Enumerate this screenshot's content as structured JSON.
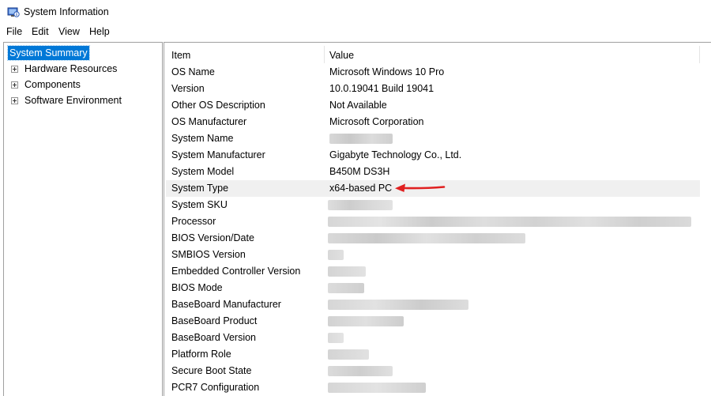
{
  "window": {
    "title": "System Information",
    "icon": "system-information-icon"
  },
  "menubar": {
    "items": [
      "File",
      "Edit",
      "View",
      "Help"
    ]
  },
  "tree": {
    "root": "System Summary",
    "items": [
      "Hardware Resources",
      "Components",
      "Software Environment"
    ]
  },
  "table": {
    "columns": [
      "Item",
      "Value"
    ],
    "rows": [
      {
        "item": "OS Name",
        "value": "Microsoft Windows 10 Pro"
      },
      {
        "item": "Version",
        "value": "10.0.19041 Build 19041"
      },
      {
        "item": "Other OS Description",
        "value": "Not Available"
      },
      {
        "item": "OS Manufacturer",
        "value": "Microsoft Corporation"
      },
      {
        "item": "System Name",
        "value": ""
      },
      {
        "item": "System Manufacturer",
        "value": "Gigabyte Technology Co., Ltd."
      },
      {
        "item": "System Model",
        "value": "B450M DS3H"
      },
      {
        "item": "System Type",
        "value": "x64-based PC"
      },
      {
        "item": "System SKU",
        "value": ""
      },
      {
        "item": "Processor",
        "value": ""
      },
      {
        "item": "BIOS Version/Date",
        "value": ""
      },
      {
        "item": "SMBIOS Version",
        "value": ""
      },
      {
        "item": "Embedded Controller Version",
        "value": ""
      },
      {
        "item": "BIOS Mode",
        "value": ""
      },
      {
        "item": "BaseBoard Manufacturer",
        "value": ""
      },
      {
        "item": "BaseBoard Product",
        "value": ""
      },
      {
        "item": "BaseBoard Version",
        "value": ""
      },
      {
        "item": "Platform Role",
        "value": ""
      },
      {
        "item": "Secure Boot State",
        "value": ""
      },
      {
        "item": "PCR7 Configuration",
        "value": ""
      }
    ]
  },
  "highlight": {
    "row": "System Type",
    "arrow_color": "#e02020"
  },
  "colors": {
    "selection": "#0078d7",
    "row_highlight": "#f0f0f0"
  }
}
